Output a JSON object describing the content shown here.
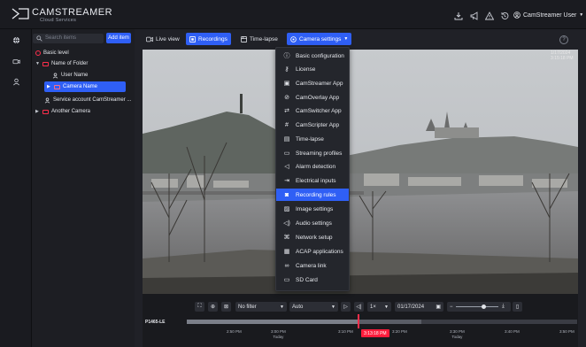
{
  "header": {
    "brand": "CAMSTREAMER",
    "brand_sub": "Cloud Services",
    "user": "CamStreamer User"
  },
  "tree": {
    "search_placeholder": "Search items",
    "add_label": "Add item",
    "rows": [
      {
        "label": "Basic level"
      },
      {
        "label": "Name of Folder"
      },
      {
        "label": "User Name"
      },
      {
        "label": "Camera Name"
      },
      {
        "label": "Service account CamStreamer ..."
      },
      {
        "label": "Another Camera"
      }
    ]
  },
  "tabs": [
    {
      "label": "Live view"
    },
    {
      "label": "Recordings"
    },
    {
      "label": "Time-lapse"
    },
    {
      "label": "Camera settings"
    }
  ],
  "menu": {
    "items": [
      {
        "label": "Basic configuration",
        "icon": "info-icon"
      },
      {
        "label": "License",
        "icon": "key-icon"
      },
      {
        "label": "CamStreamer App",
        "icon": "film-icon"
      },
      {
        "label": "CamOverlay App",
        "icon": "overlay-icon"
      },
      {
        "label": "CamSwitcher App",
        "icon": "switch-icon"
      },
      {
        "label": "CamScripter App",
        "icon": "hash-icon"
      },
      {
        "label": "Time-lapse",
        "icon": "timelapse-icon"
      },
      {
        "label": "Streaming profiles",
        "icon": "stream-icon"
      },
      {
        "label": "Alarm detection",
        "icon": "megaphone-icon"
      },
      {
        "label": "Electrical inputs",
        "icon": "input-icon"
      },
      {
        "label": "Recording rules",
        "icon": "record-icon"
      },
      {
        "label": "Image settings",
        "icon": "image-icon"
      },
      {
        "label": "Audio settings",
        "icon": "audio-icon"
      },
      {
        "label": "Network setup",
        "icon": "network-icon"
      },
      {
        "label": "ACAP applications",
        "icon": "grid-icon"
      },
      {
        "label": "Camera link",
        "icon": "link-icon"
      },
      {
        "label": "SD Card",
        "icon": "sdcard-icon"
      }
    ]
  },
  "video": {
    "timestamp": "1/17/2024 3:15:18 PM"
  },
  "controls": {
    "filter": "No filter",
    "quality": "Auto",
    "speed": "1×",
    "date": "01/17/2024"
  },
  "timeline": {
    "camera": "P1465-LE",
    "current_time": "3:13:18 PM",
    "ticks": [
      {
        "time": "2:50 PM",
        "day": ""
      },
      {
        "time": "3:00 PM",
        "day": "Today"
      },
      {
        "time": "3:10 PM",
        "day": ""
      },
      {
        "time": "3:20 PM",
        "day": ""
      },
      {
        "time": "3:30 PM",
        "day": "Today"
      },
      {
        "time": "3:40 PM",
        "day": ""
      },
      {
        "time": "3:50 PM",
        "day": ""
      }
    ]
  },
  "colors": {
    "accent": "#2f5ff5",
    "alert": "#ff2e4b"
  }
}
